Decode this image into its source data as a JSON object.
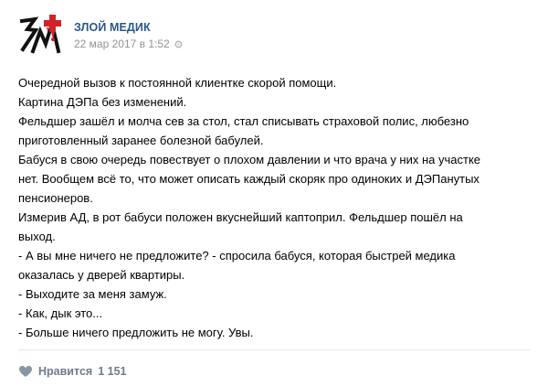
{
  "post": {
    "author": "ЗЛОЙ МЕДИК",
    "date": "22 мар 2017 в 1:52",
    "icons": {
      "avatar": "zloy-medik-logo",
      "meta": "settings-gear-icon",
      "like": "heart-icon"
    },
    "text_lines": [
      "Очередной вызов к постоянной клиентке скорой помощи.",
      "Картина ДЭПа без изменений.",
      "Фельдшер зашёл и молча сев за стол, стал списывать страховой полис, любезно",
      "приготовленный заранее болезной бабулей.",
      "Бабуся в свою очередь повествует о плохом давлении и что врача у них на участке",
      "нет. Вообщем всё то, что может описать каждый скоряк про одиноких и ДЭПанутых",
      "пенсионеров.",
      "Измерив АД, в рот бабуси положен вкуснейший каптоприл. Фельдшер пошёл на",
      "выход.",
      "- А вы мне ничего не предложите? - спросила бабуся, которая быстрей медика",
      "оказалась у дверей квартиры.",
      "- Выходите за меня замуж.",
      "- Как, дык это...",
      "- Больше ничего предложить не могу. Увы."
    ],
    "like_label": "Нравится",
    "like_count": "1 151"
  },
  "colors": {
    "author_link": "#2a5885",
    "meta_gray": "#939393",
    "like_gray": "#6f7b8a",
    "logo_red": "#d4202a",
    "logo_black": "#111111"
  }
}
